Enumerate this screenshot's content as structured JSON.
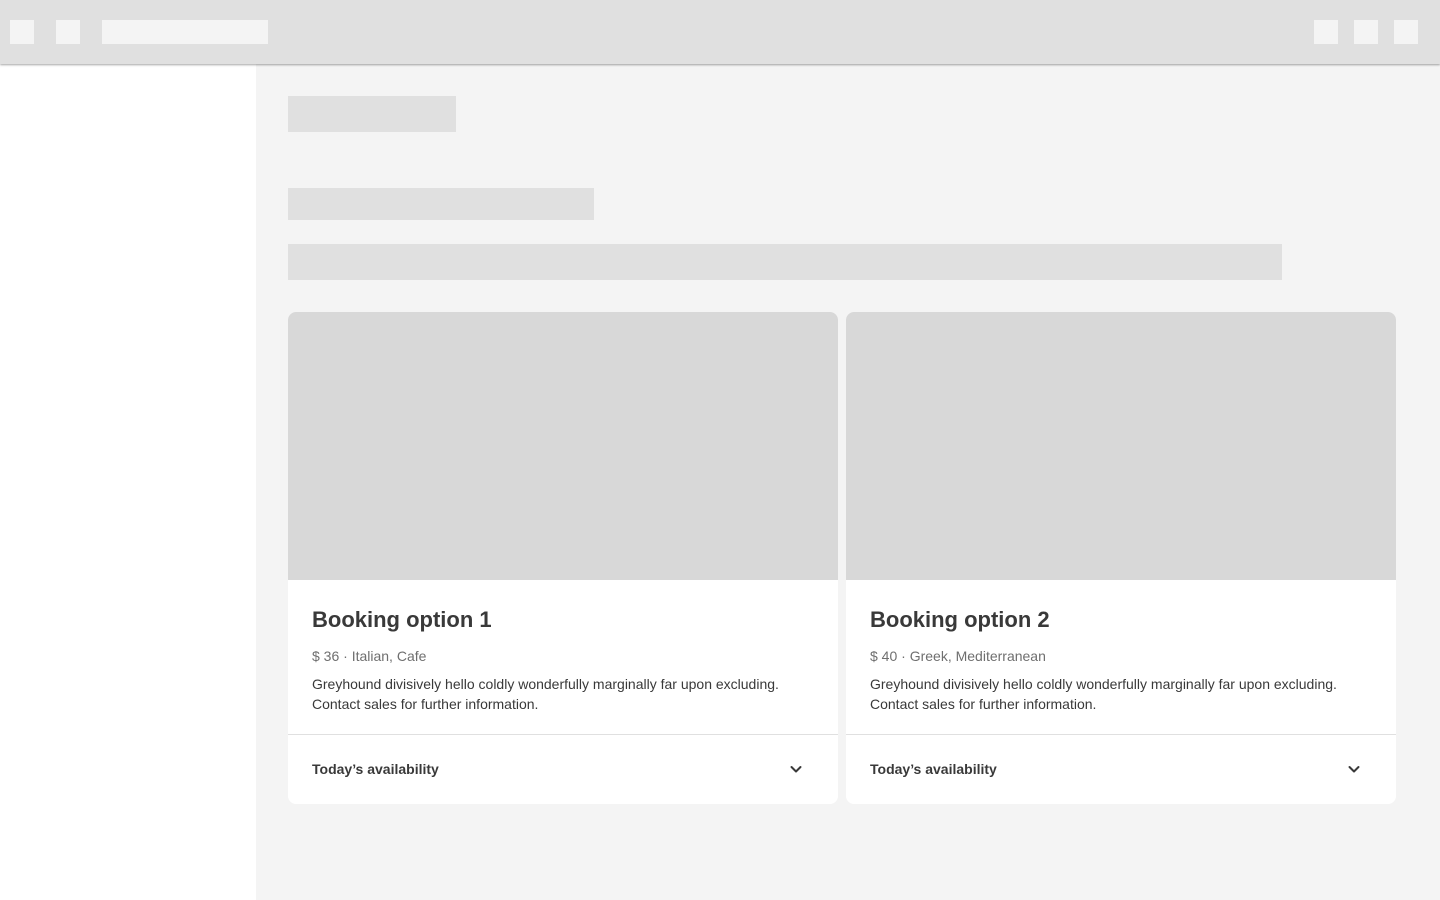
{
  "cards": [
    {
      "title": "Booking option 1",
      "meta": "$ 36 · Italian, Cafe",
      "description": "Greyhound divisively hello coldly wonderfully marginally far upon excluding. Contact sales for further information.",
      "availability_label": "Today’s availability"
    },
    {
      "title": "Booking option 2",
      "meta": "$ 40 · Greek, Mediterranean",
      "description": "Greyhound divisively hello coldly wonderfully marginally far upon excluding. Contact sales for further information.",
      "availability_label": "Today’s availability"
    }
  ],
  "icons": {
    "toggle": "chevron-down-icon"
  },
  "colors": {
    "topbar": "#e0e0e0",
    "sidebar": "#ffffff",
    "background": "#f4f4f4",
    "placeholder": "#e0e0e0",
    "card_media": "#d8d8d8",
    "text_primary": "#393939",
    "text_secondary": "#6f6f6f"
  }
}
